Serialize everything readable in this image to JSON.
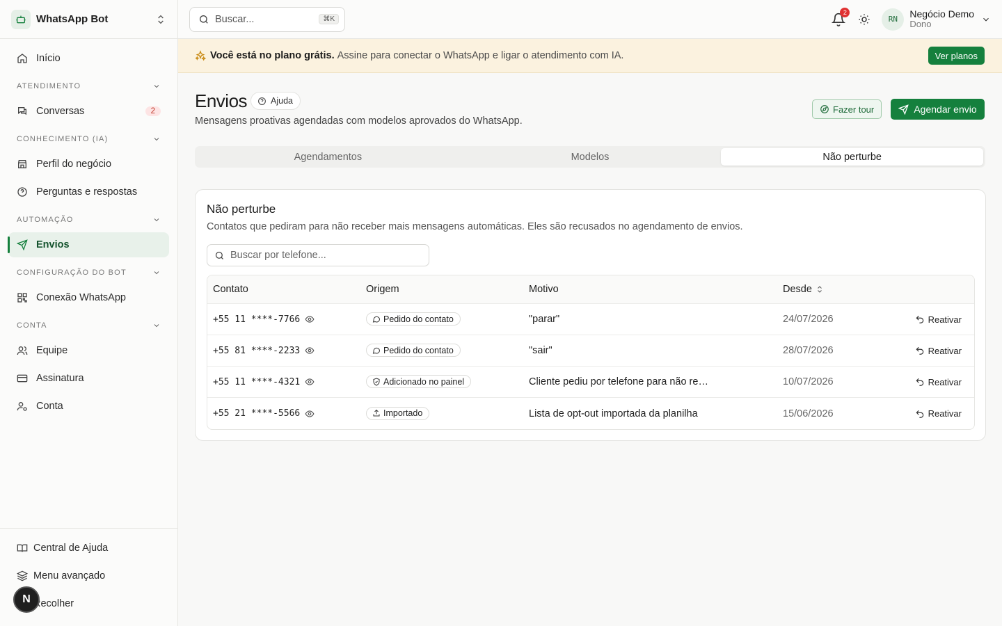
{
  "brand": {
    "name": "WhatsApp Bot"
  },
  "sidebar": {
    "home": "Início",
    "sections": [
      {
        "label": "ATENDIMENTO"
      },
      {
        "label": "CONHECIMENTO (IA)"
      },
      {
        "label": "AUTOMAÇÃO"
      },
      {
        "label": "CONFIGURAÇÃO DO BOT"
      },
      {
        "label": "CONTA"
      }
    ],
    "items": {
      "conversas": "Conversas",
      "conversas_badge": "2",
      "perfil": "Perfil do negócio",
      "perguntas": "Perguntas e respostas",
      "envios": "Envios",
      "conexao": "Conexão WhatsApp",
      "equipe": "Equipe",
      "assinatura": "Assinatura",
      "conta": "Conta"
    },
    "bottom": {
      "help": "Central de Ajuda",
      "advanced": "Menu avançado",
      "collapse": "Recolher",
      "n_badge": "N"
    }
  },
  "topbar": {
    "search_placeholder": "Buscar...",
    "shortcut": "⌘K",
    "notifications_count": "2",
    "avatar_initials": "RN",
    "user_name": "Negócio Demo",
    "user_role": "Dono"
  },
  "banner": {
    "strong": "Você está no plano grátis.",
    "text": "Assine para conectar o WhatsApp e ligar o atendimento com IA.",
    "button": "Ver planos"
  },
  "page": {
    "title": "Envios",
    "help": "Ajuda",
    "subtitle": "Mensagens proativas agendadas com modelos aprovados do WhatsApp.",
    "tour_button": "Fazer tour",
    "schedule_button": "Agendar envio",
    "tabs": [
      "Agendamentos",
      "Modelos",
      "Não perturbe"
    ],
    "active_tab": "Não perturbe"
  },
  "card": {
    "title": "Não perturbe",
    "description": "Contatos que pediram para não receber mais mensagens automáticas. Eles são recusados no agendamento de envios.",
    "search_placeholder": "Buscar por telefone..."
  },
  "table": {
    "headers": [
      "Contato",
      "Origem",
      "Motivo",
      "Desde"
    ],
    "rows": [
      {
        "contact": "+55 11 ****-7766",
        "origin": "Pedido do contato",
        "origin_icon": "chat-bubble-icon",
        "reason": "\"parar\"",
        "since": "24/07/2026",
        "action": "Reativar"
      },
      {
        "contact": "+55 81 ****-2233",
        "origin": "Pedido do contato",
        "origin_icon": "chat-bubble-icon",
        "reason": "\"sair\"",
        "since": "28/07/2026",
        "action": "Reativar"
      },
      {
        "contact": "+55 11 ****-4321",
        "origin": "Adicionado no painel",
        "origin_icon": "shield-icon",
        "reason": "Cliente pediu por telefone para não receber mais mensagens",
        "since": "10/07/2026",
        "action": "Reativar"
      },
      {
        "contact": "+55 21 ****-5566",
        "origin": "Importado",
        "origin_icon": "upload-icon",
        "reason": "Lista de opt-out importada da planilha",
        "since": "15/06/2026",
        "action": "Reativar"
      }
    ]
  },
  "colors": {
    "accent": "#15803d",
    "banner_bg": "#fbf2df",
    "badge_red": "#e03131"
  }
}
